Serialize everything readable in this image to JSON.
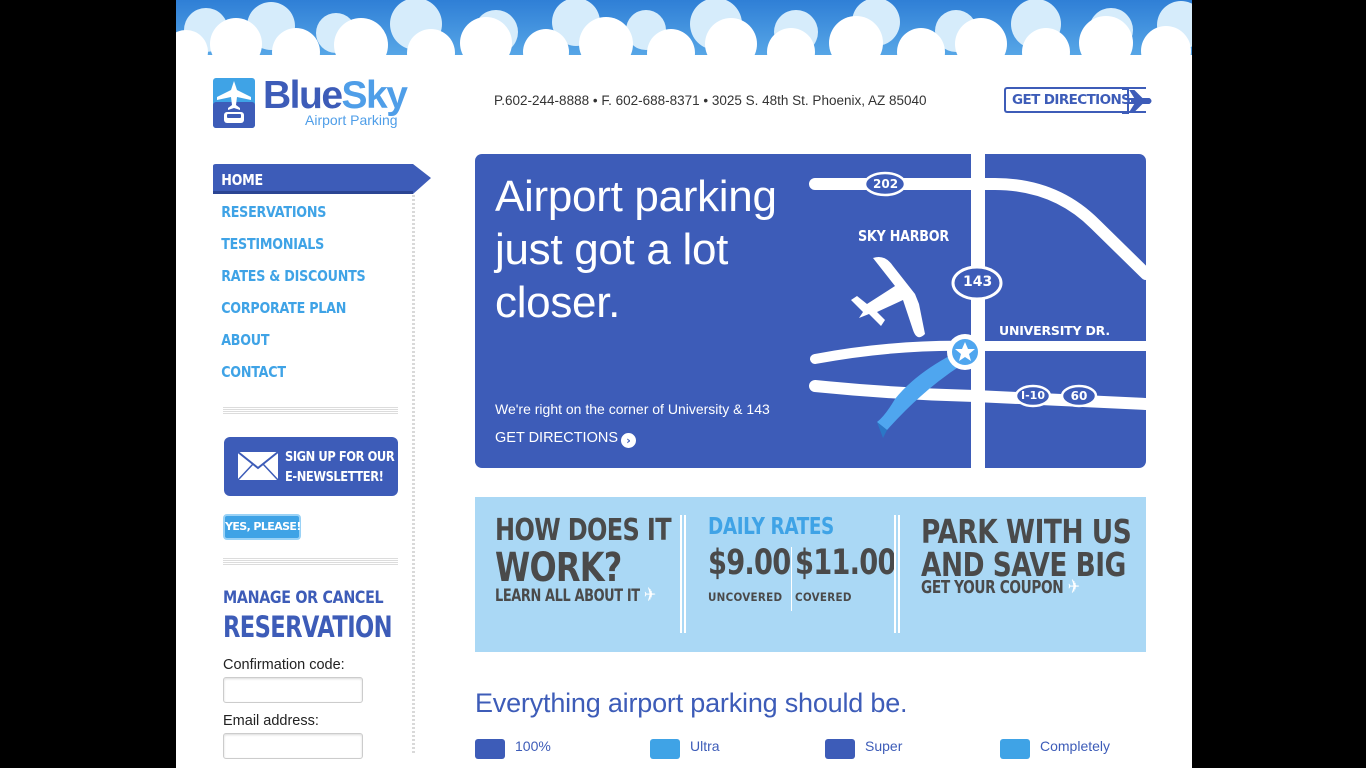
{
  "brand": {
    "name_part1": "Blue",
    "name_part2": "Sky",
    "subtitle": "Airport Parking"
  },
  "header": {
    "contact": "P.602-244-8888 • F. 602-688-8371 • 3025 S. 48th St. Phoenix, AZ 85040",
    "directions_button": "GET DIRECTIONS"
  },
  "nav": {
    "items": [
      {
        "label": "HOME",
        "active": true
      },
      {
        "label": "RESERVATIONS"
      },
      {
        "label": "TESTIMONIALS"
      },
      {
        "label": "RATES & DISCOUNTS"
      },
      {
        "label": "CORPORATE PLAN"
      },
      {
        "label": "ABOUT"
      },
      {
        "label": "CONTACT"
      }
    ]
  },
  "newsletter": {
    "line1": "SIGN UP FOR OUR",
    "line2": "E-NEWSLETTER!",
    "button": "YES, PLEASE!"
  },
  "manage": {
    "line1": "MANAGE OR CANCEL",
    "line2": "RESERVATION",
    "confirmation_label": "Confirmation code:",
    "email_label": "Email address:"
  },
  "hero": {
    "title": "Airport parking just got a lot closer.",
    "subtitle": "We're right on the corner of University & 143",
    "link": "GET DIRECTIONS",
    "map": {
      "road_202": "202",
      "road_143": "143",
      "road_i10": "I-10",
      "road_60": "60",
      "sky_harbor": "SKY HARBOR",
      "university": "UNIVERSITY DR."
    }
  },
  "info": {
    "how_line1": "HOW DOES IT",
    "how_line2": "WORK?",
    "how_link": "LEARN ALL ABOUT IT",
    "rates_title": "DAILY RATES",
    "uncovered_price": "$9.00",
    "uncovered_label": "UNCOVERED",
    "covered_price": "$11.00",
    "covered_label": "COVERED",
    "park_line1": "PARK WITH US",
    "park_line2": "AND SAVE BIG",
    "coupon_link": "GET YOUR COUPON"
  },
  "tagline": "Everything airport parking should be.",
  "features": [
    "100%",
    "Ultra",
    "Super",
    "Completely"
  ],
  "colors": {
    "brand_blue": "#3d5cb8",
    "light_blue": "#3fa3e6",
    "strip_blue": "#aad8f5"
  }
}
